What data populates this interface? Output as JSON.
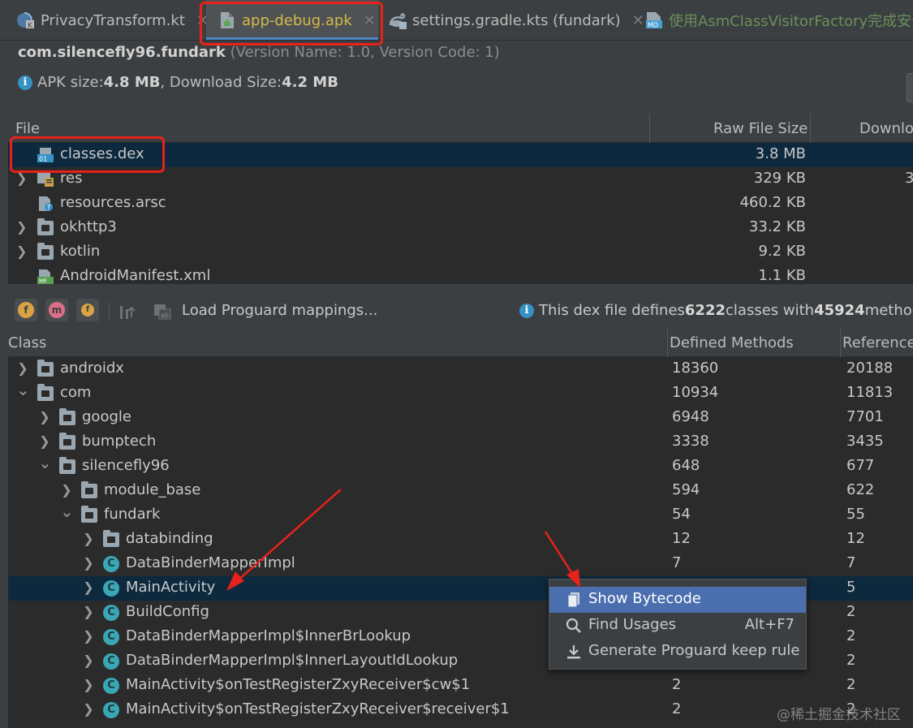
{
  "tabs": [
    {
      "label": "PrivacyTransform.kt",
      "icon": "kotlin-file-icon",
      "active": false
    },
    {
      "label": "app-debug.apk",
      "icon": "apk-file-icon",
      "active": true
    },
    {
      "label": "settings.gradle.kts (fundark)",
      "icon": "gradle-file-icon",
      "active": false
    },
    {
      "label": "使用AsmClassVisitorFactory完成安全",
      "icon": "markdown-file-icon",
      "active": false
    }
  ],
  "apk": {
    "package": "com.silencefly96.fundark",
    "version": "(Version Name: 1.0, Version Code: 1)",
    "apk_size_label": "APK size: ",
    "apk_size": "4.8 MB",
    "download_label": ", Download Size: ",
    "download_size": "4.2 MB"
  },
  "file_table": {
    "headers": [
      "File",
      "Raw File Size",
      "Downlo"
    ],
    "rows": [
      {
        "name": "classes.dex",
        "size": "3.8 MB",
        "dl": "",
        "expandable": false,
        "icon": "dex-file-icon",
        "selected": true
      },
      {
        "name": "res",
        "size": "329 KB",
        "dl": "3",
        "expandable": true,
        "icon": "res-folder-icon",
        "selected": false
      },
      {
        "name": "resources.arsc",
        "size": "460.2 KB",
        "dl": "",
        "expandable": false,
        "icon": "arsc-file-icon",
        "selected": false
      },
      {
        "name": "okhttp3",
        "size": "33.2 KB",
        "dl": "",
        "expandable": true,
        "icon": "folder-icon",
        "selected": false
      },
      {
        "name": "kotlin",
        "size": "9.2 KB",
        "dl": "",
        "expandable": true,
        "icon": "folder-icon",
        "selected": false
      },
      {
        "name": "AndroidManifest.xml",
        "size": "1.1 KB",
        "dl": "",
        "expandable": false,
        "icon": "manifest-file-icon",
        "selected": false
      }
    ]
  },
  "toolbar": {
    "btn_f": "f",
    "btn_m": "m",
    "btn_rf": "f",
    "load_label": "Load Proguard mappings...",
    "info_pre": "This dex file defines ",
    "classes_count": "6222",
    "info_mid": " classes with ",
    "methods_count": "45924",
    "info_post": " methods"
  },
  "class_table": {
    "headers": [
      "Class",
      "Defined Methods",
      "Referenced"
    ],
    "rows": [
      {
        "name": "androidx",
        "def": "18360",
        "ref": "20188",
        "depth": 0,
        "arrow": "collapsed",
        "kind": "package"
      },
      {
        "name": "com",
        "def": "10934",
        "ref": "11813",
        "depth": 0,
        "arrow": "expanded",
        "kind": "package"
      },
      {
        "name": "google",
        "def": "6948",
        "ref": "7701",
        "depth": 1,
        "arrow": "collapsed",
        "kind": "package"
      },
      {
        "name": "bumptech",
        "def": "3338",
        "ref": "3435",
        "depth": 1,
        "arrow": "collapsed",
        "kind": "package"
      },
      {
        "name": "silencefly96",
        "def": "648",
        "ref": "677",
        "depth": 1,
        "arrow": "expanded",
        "kind": "package"
      },
      {
        "name": "module_base",
        "def": "594",
        "ref": "622",
        "depth": 2,
        "arrow": "collapsed",
        "kind": "package"
      },
      {
        "name": "fundark",
        "def": "54",
        "ref": "55",
        "depth": 2,
        "arrow": "expanded",
        "kind": "package"
      },
      {
        "name": "databinding",
        "def": "12",
        "ref": "12",
        "depth": 3,
        "arrow": "collapsed",
        "kind": "package"
      },
      {
        "name": "DataBinderMapperImpl",
        "def": "7",
        "ref": "7",
        "depth": 3,
        "arrow": "collapsed",
        "kind": "class"
      },
      {
        "name": "MainActivity",
        "def": "",
        "ref": "5",
        "depth": 3,
        "arrow": "collapsed",
        "kind": "class",
        "selected": true
      },
      {
        "name": "BuildConfig",
        "def": "",
        "ref": "2",
        "depth": 3,
        "arrow": "collapsed",
        "kind": "class"
      },
      {
        "name": "DataBinderMapperImpl$InnerBrLookup",
        "def": "",
        "ref": "2",
        "depth": 3,
        "arrow": "collapsed",
        "kind": "class"
      },
      {
        "name": "DataBinderMapperImpl$InnerLayoutIdLookup",
        "def": "",
        "ref": "2",
        "depth": 3,
        "arrow": "collapsed",
        "kind": "class"
      },
      {
        "name": "MainActivity$onTestRegisterZxyReceiver$cw$1",
        "def": "2",
        "ref": "2",
        "depth": 3,
        "arrow": "collapsed",
        "kind": "class"
      },
      {
        "name": "MainActivity$onTestRegisterZxyReceiver$receiver$1",
        "def": "2",
        "ref": "2",
        "depth": 3,
        "arrow": "collapsed",
        "kind": "class"
      }
    ]
  },
  "context_menu": {
    "items": [
      {
        "label": "Show Bytecode",
        "shortcut": "",
        "icon": "bytecode-icon",
        "highlighted": true
      },
      {
        "label": "Find Usages",
        "shortcut": "Alt+F7",
        "icon": "search-icon",
        "highlighted": false
      },
      {
        "label": "Generate Proguard keep rule",
        "shortcut": "",
        "icon": "download-icon",
        "highlighted": false
      }
    ]
  },
  "watermark": "@稀土掘金技术社区",
  "colors": {
    "background": "#3c3f41",
    "table_bg": "#2b2b2b",
    "selection": "#0d293e",
    "menu_highlight": "#4b6eaf",
    "annotation_red": "#e8221b",
    "active_tab_text": "#d4b94a"
  }
}
